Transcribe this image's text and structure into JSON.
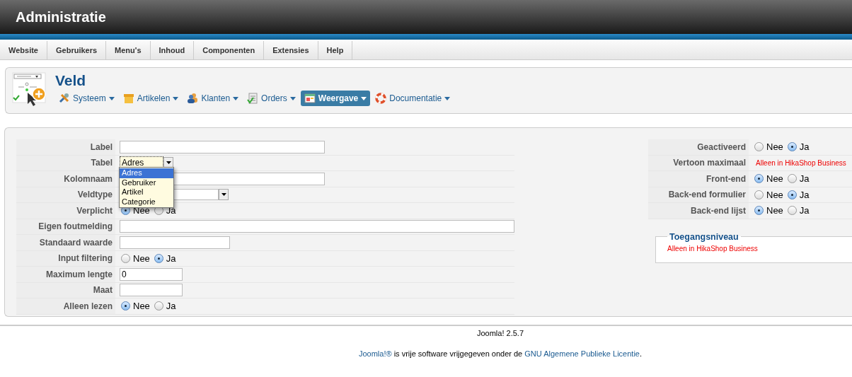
{
  "header": {
    "title": "Administratie"
  },
  "menu": {
    "items": [
      {
        "label": "Website"
      },
      {
        "label": "Gebruikers"
      },
      {
        "label": "Menu's"
      },
      {
        "label": "Inhoud"
      },
      {
        "label": "Componenten"
      },
      {
        "label": "Extensies"
      },
      {
        "label": "Help"
      }
    ]
  },
  "toolbar": {
    "title": "Veld",
    "items": [
      {
        "label": "Systeem",
        "selected": false
      },
      {
        "label": "Artikelen",
        "selected": false
      },
      {
        "label": "Klanten",
        "selected": false
      },
      {
        "label": "Orders",
        "selected": false
      },
      {
        "label": "Weergave",
        "selected": true
      },
      {
        "label": "Documentatie",
        "selected": false
      }
    ]
  },
  "form_left": [
    {
      "kind": "text",
      "label": "Label"
    },
    {
      "kind": "select",
      "label": "Tabel",
      "value": "Adres",
      "open": true,
      "options": [
        {
          "label": "Adres",
          "selected": true
        },
        {
          "label": "Gebruiker",
          "selected": false
        },
        {
          "label": "Artikel",
          "selected": false
        },
        {
          "label": "Categorie",
          "selected": false
        }
      ]
    },
    {
      "kind": "text",
      "label": "Kolomnaam"
    },
    {
      "kind": "select",
      "label": "Veldtype"
    },
    {
      "kind": "radio",
      "label": "Verplicht",
      "options": [
        {
          "label": "Nee",
          "selected": true
        },
        {
          "label": "Ja",
          "selected": false
        }
      ]
    },
    {
      "kind": "text",
      "label": "Eigen foutmelding"
    },
    {
      "kind": "text",
      "label": "Standaard waarde"
    },
    {
      "kind": "radio",
      "label": "Input filtering",
      "options": [
        {
          "label": "Nee",
          "selected": false
        },
        {
          "label": "Ja",
          "selected": true
        }
      ]
    },
    {
      "kind": "text",
      "label": "Maximum lengte",
      "value": "0"
    },
    {
      "kind": "text",
      "label": "Maat"
    },
    {
      "kind": "radio",
      "label": "Alleen lezen",
      "options": [
        {
          "label": "Nee",
          "selected": true
        },
        {
          "label": "Ja",
          "selected": false
        }
      ]
    }
  ],
  "form_right": [
    {
      "kind": "radio",
      "label": "Geactiveerd",
      "options": [
        {
          "label": "Nee",
          "selected": false
        },
        {
          "label": "Ja",
          "selected": true
        }
      ]
    },
    {
      "kind": "note",
      "label": "Vertoon maximaal",
      "note": "Alleen in HikaShop Business"
    },
    {
      "kind": "radio",
      "label": "Front-end",
      "options": [
        {
          "label": "Nee",
          "selected": true
        },
        {
          "label": "Ja",
          "selected": false
        }
      ]
    },
    {
      "kind": "radio",
      "label": "Back-end formulier",
      "options": [
        {
          "label": "Nee",
          "selected": false
        },
        {
          "label": "Ja",
          "selected": true
        }
      ]
    },
    {
      "kind": "radio",
      "label": "Back-end lijst",
      "options": [
        {
          "label": "Nee",
          "selected": true
        },
        {
          "label": "Ja",
          "selected": false
        }
      ]
    }
  ],
  "access_fieldset": {
    "legend": "Toegangsniveau",
    "note": "Alleen in HikaShop Business"
  },
  "footer": {
    "version": "Joomla! 2.5.7",
    "license": [
      {
        "text": "Joomla!®",
        "link": true
      },
      {
        "text": " is vrije software vrijgegeven onder de "
      },
      {
        "text": "GNU Algemene Publieke Licentie",
        "link": true
      },
      {
        "text": "."
      }
    ]
  }
}
